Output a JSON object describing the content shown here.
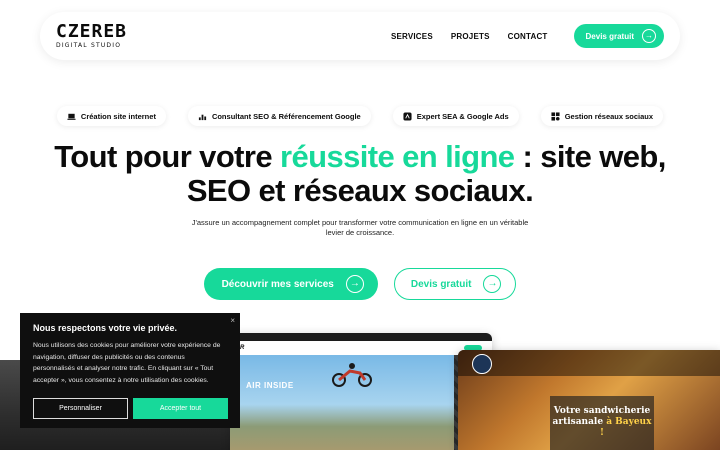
{
  "header": {
    "logo_main": "CZEREB",
    "logo_sub": "DIGITAL STUDIO",
    "nav": [
      "SERVICES",
      "PROJETS",
      "CONTACT"
    ],
    "cta_label": "Devis gratuit"
  },
  "chips": [
    {
      "label": "Création site internet",
      "icon": "laptop-icon"
    },
    {
      "label": "Consultant SEO & Référencement Google",
      "icon": "ranking-icon"
    },
    {
      "label": "Expert SEA & Google Ads",
      "icon": "ads-icon"
    },
    {
      "label": "Gestion réseaux sociaux",
      "icon": "social-icon"
    }
  ],
  "hero": {
    "line1_before": "Tout pour votre ",
    "line1_accent": "réussite en ligne",
    "line1_after": " : site web,",
    "line2": "SEO et réseaux sociaux.",
    "subtext": "J'assure un accompagnement complet pour transformer votre communication en ligne en un véritable levier de croissance.",
    "primary_cta": "Découvrir mes services",
    "secondary_cta": "Devis gratuit"
  },
  "showcase": {
    "shot1_title": "AIR INSIDE",
    "shot2_line1": "Votre sandwicherie",
    "shot2_line2_before": "artisanale ",
    "shot2_line2_accent": "à Bayeux !"
  },
  "cookie": {
    "title": "Nous respectons votre vie privée.",
    "text": "Nous utilisons des cookies pour améliorer votre expérience de navigation, diffuser des publicités ou des contenus personnalisés et analyser notre trafic. En cliquant sur « Tout accepter », vous consentez à notre utilisation des cookies.",
    "customize": "Personnaliser",
    "accept": "Accepter tout",
    "close": "×"
  },
  "colors": {
    "accent": "#17d99a",
    "text": "#0b0b0b",
    "banner_bg": "#0f0f0f"
  }
}
